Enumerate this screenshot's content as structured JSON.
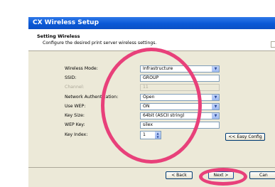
{
  "window": {
    "title": "CX Wireless Setup"
  },
  "header": {
    "title": "Setting Wireless",
    "description": "Configure the desired print server wireless settings."
  },
  "form": {
    "wireless_mode": {
      "label": "Wireless Mode:",
      "value": "Infrastructure"
    },
    "ssid": {
      "label": "SSID:",
      "value": "GROUP"
    },
    "channel": {
      "label": "Channel:",
      "value": "11"
    },
    "network_auth": {
      "label": "Network Authentication:",
      "value": "Open"
    },
    "use_wep": {
      "label": "Use WEP:",
      "value": "ON"
    },
    "key_size": {
      "label": "Key Size:",
      "value": "64bit (ASCII string)"
    },
    "wep_key": {
      "label": "WEP Key:",
      "value": "silex"
    },
    "key_index": {
      "label": "Key Index:",
      "value": "1"
    }
  },
  "buttons": {
    "easy_config": "<< Easy Config",
    "back": "< Back",
    "next": "Next >",
    "cancel": "Can"
  },
  "colors": {
    "titlebar": "#0a58d6",
    "highlight": "#e8407a",
    "panel": "#ece9d8"
  }
}
